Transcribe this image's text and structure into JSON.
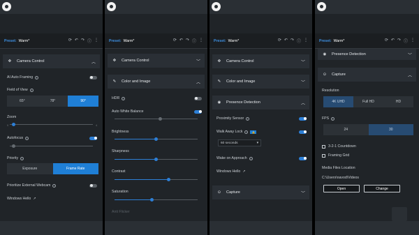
{
  "preset": {
    "label": "Preset:",
    "value": "Warm*"
  },
  "p1": {
    "section_title": "Camera Control",
    "ai_auto_framing": "AI Auto Framing",
    "field_of_view": "Field of View",
    "fov_options": [
      "65°",
      "78°",
      "90°"
    ],
    "fov_selected": 2,
    "zoom": "Zoom",
    "zoom_min": "0",
    "zoom_max": "4",
    "autofocus": "Autofocus",
    "priority": "Priority",
    "priority_options": [
      "Exposure",
      "Frame Rate"
    ],
    "prioritize_webcam": "Prioritize External Webcam",
    "windows_hello": "Windows Hello"
  },
  "p2": {
    "camera_control": "Camera Control",
    "color_image": "Color and Image",
    "hdr": "HDR",
    "awb": "Auto White Balance",
    "brightness": "Brightness",
    "sharpness": "Sharpness",
    "contrast": "Contrast",
    "saturation": "Saturation",
    "anti_flicker": "Anti Flicker",
    "brightness_level": 0.5,
    "sharpness_level": 0.5,
    "contrast_level": 0.65,
    "saturation_level": 0.45
  },
  "p3": {
    "camera_control": "Camera Control",
    "color_image": "Color and Image",
    "presence": "Presence Detection",
    "proximity": "Proximity Sensor",
    "walk_away": "Walk Away Lock",
    "lock_badge": "🔒",
    "walk_delay": "60 seconds",
    "wake": "Wake on Approach",
    "windows_hello": "Windows Hello",
    "capture": "Capture"
  },
  "p4": {
    "presence": "Presence Detection",
    "capture": "Capture",
    "resolution": "Resolution",
    "res_options": [
      "4K UHD",
      "Full HD",
      "HD"
    ],
    "fps": "FPS",
    "fps_options": [
      "24",
      "30"
    ],
    "countdown": "3-2-1 Countdown",
    "framing_grid": "Framing Grid",
    "media_location": "Media Files Location",
    "media_path": "C:\\Users\\navod\\Videos",
    "open": "Open",
    "change": "Change"
  },
  "colors": {
    "accent": "#1f7fd6",
    "panel": "#202428",
    "header": "#2a2f35"
  }
}
